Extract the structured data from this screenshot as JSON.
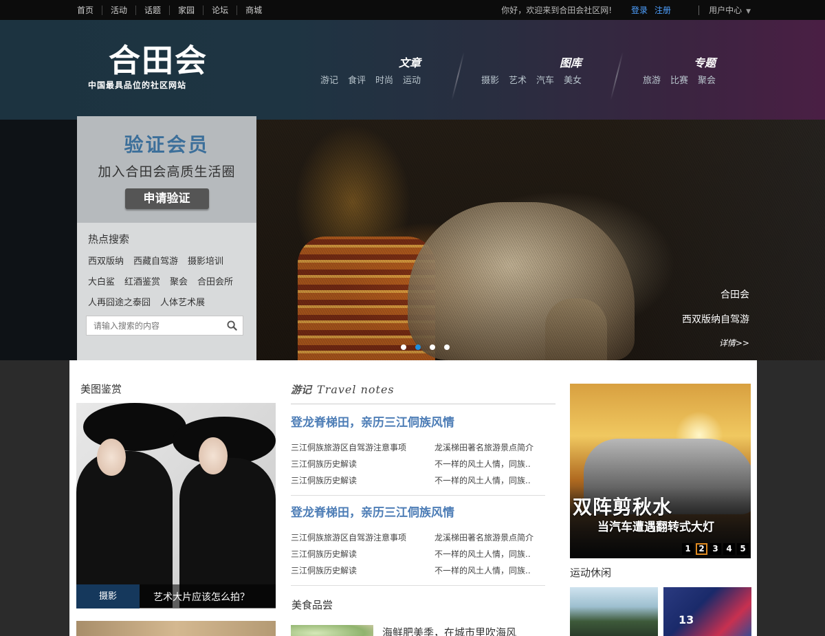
{
  "topbar": {
    "nav": [
      "首页",
      "活动",
      "话题",
      "家园",
      "论坛",
      "商城"
    ],
    "welcome": "你好，欢迎来到合田会社区网!",
    "login": "登录",
    "register": "注册",
    "user_center": "用户中心",
    "caret": "▼"
  },
  "header": {
    "logo_main": "合田会",
    "logo_sub": "中国最具品位的社区网站",
    "groups": [
      {
        "title": "文章",
        "links": [
          "游记",
          "食评",
          "时尚",
          "运动"
        ]
      },
      {
        "title": "图库",
        "links": [
          "摄影",
          "艺术",
          "汽车",
          "美女"
        ]
      },
      {
        "title": "专题",
        "links": [
          "旅游",
          "比赛",
          "聚会"
        ]
      }
    ]
  },
  "hero": {
    "verify_title": "验证会员",
    "verify_sub": "加入合田会高质生活圈",
    "verify_button": "申请验证",
    "hot_title": "热点搜索",
    "hot_rows": [
      [
        "西双版纳",
        "西藏自驾游",
        "摄影培训"
      ],
      [
        "大白鲨",
        "红酒鉴赏",
        "聚会",
        "合田会所"
      ],
      [
        "人再囧途之泰囧",
        "人体艺术展"
      ]
    ],
    "search_placeholder": "请输入搜索的内容",
    "caption_1": "合田会",
    "caption_2": "西双版纳自驾游",
    "caption_more": "详情>>",
    "dots": 4,
    "active_dot": 2
  },
  "content": {
    "beauty_title": "美图鉴赏",
    "beauty_tag": "摄影",
    "beauty_caption": "艺术大片应该怎么拍？",
    "travel_cn": "游记",
    "travel_en": "Travel notes",
    "articles": [
      {
        "headline": "登龙脊梯田，亲历三江侗族风情",
        "rows": [
          [
            "三江侗族旅游区自驾游注意事项",
            "龙溪梯田著名旅游景点简介"
          ],
          [
            "三江侗族历史解读",
            "不一样的风土人情，同族.."
          ],
          [
            "三江侗族历史解读",
            "不一样的风土人情，同族.."
          ]
        ]
      },
      {
        "headline": "登龙脊梯田，亲历三江侗族风情",
        "rows": [
          [
            "三江侗族旅游区自驾游注意事项",
            "龙溪梯田著名旅游景点简介"
          ],
          [
            "三江侗族历史解读",
            "不一样的风土人情，同族.."
          ],
          [
            "三江侗族历史解读",
            "不一样的风土人情，同族.."
          ]
        ]
      }
    ],
    "food_title": "美食品尝",
    "food_text": "海鲜肥美季，在城市里吹海风",
    "car_headline": "双阵剪秋水",
    "car_sub": "当汽车遭遇翻转式大灯",
    "car_pages": [
      "1",
      "2",
      "3",
      "4",
      "5"
    ],
    "car_active_page": 2,
    "sports_title": "运动休闲",
    "sports_jersey": "13"
  }
}
